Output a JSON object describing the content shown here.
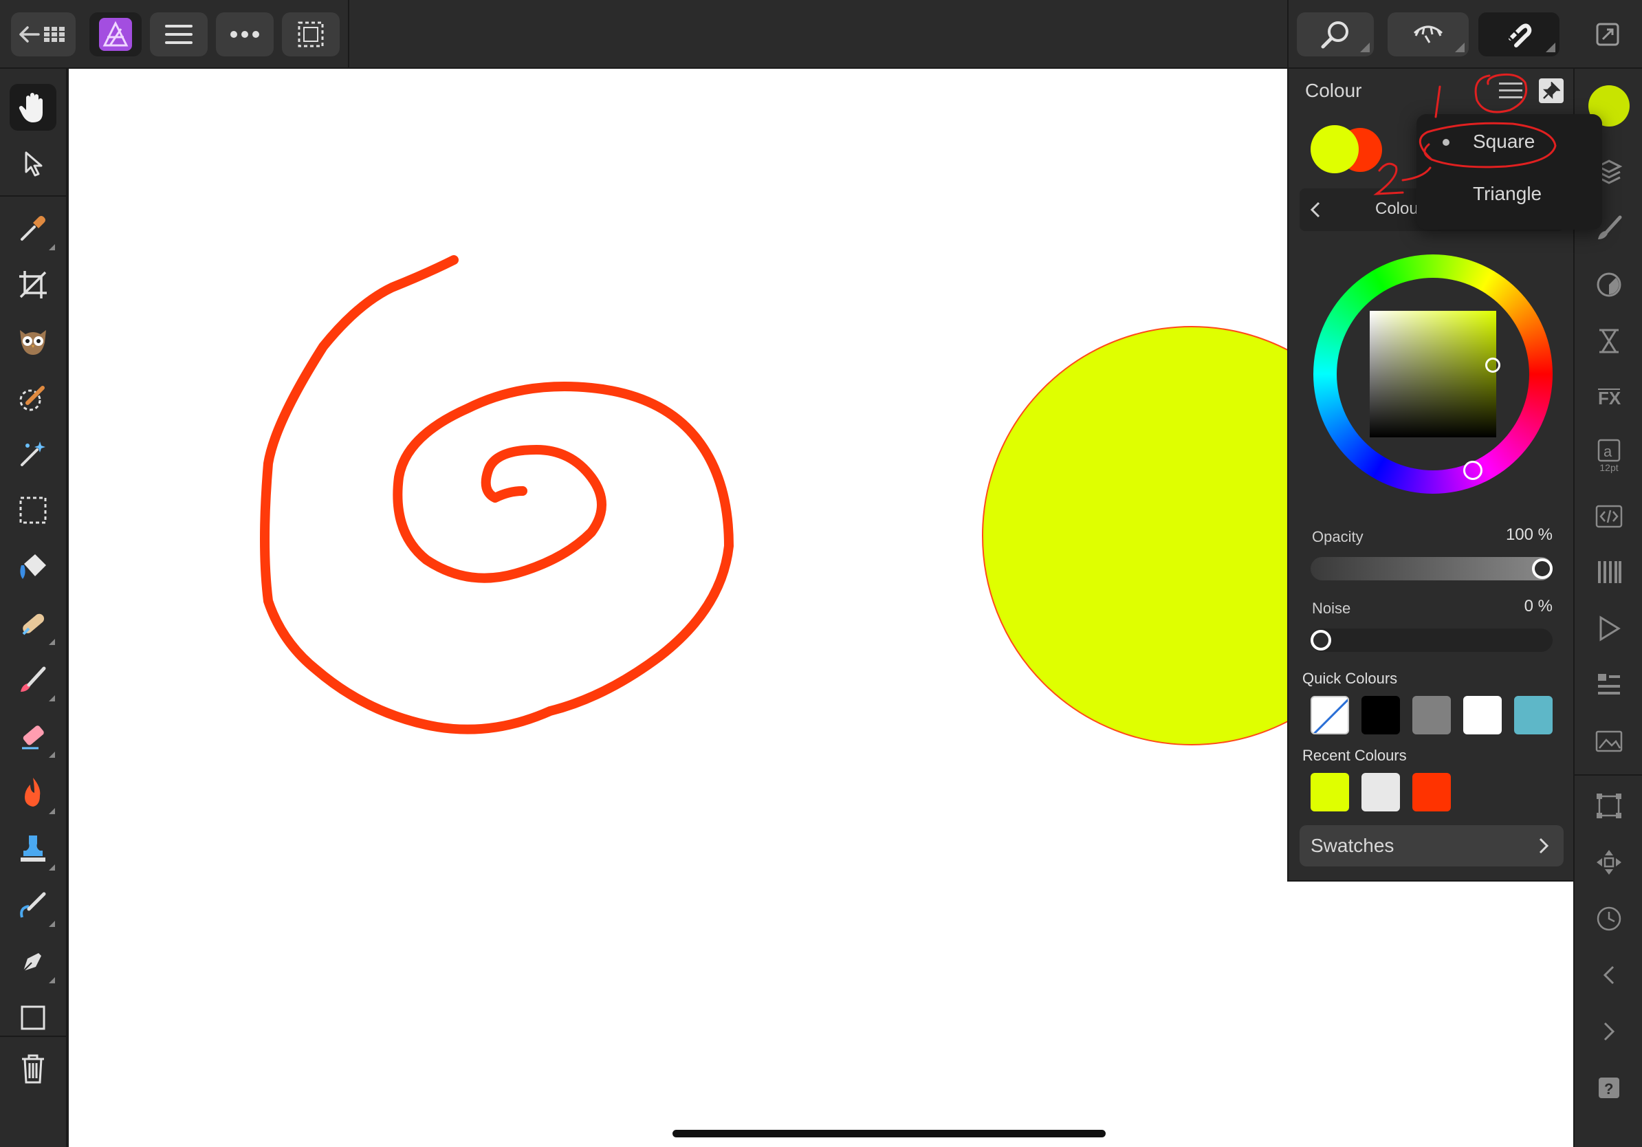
{
  "app": {
    "accent_color": "#a34ee0"
  },
  "top_toolbar": {
    "left_buttons": [
      {
        "id": "back-to-gallery",
        "icon": "back-grid-icon"
      },
      {
        "id": "persona",
        "icon": "affinity-photo-logo"
      },
      {
        "id": "document-menu",
        "icon": "hamburger-icon"
      },
      {
        "id": "more-menu",
        "icon": "ellipsis-icon"
      },
      {
        "id": "selection",
        "icon": "marquee-icon"
      }
    ],
    "right_buttons": [
      {
        "id": "zoom",
        "icon": "magnifier-icon"
      },
      {
        "id": "view-quality",
        "icon": "eye-icon"
      },
      {
        "id": "snapping",
        "icon": "magnet-icon"
      },
      {
        "id": "fullscreen",
        "icon": "expand-icon"
      }
    ]
  },
  "left_tools": [
    "hand-tool",
    "move-tool",
    "colour-picker-tool",
    "crop-tool",
    "owl-tool",
    "selection-brush-tool",
    "magic-wand-tool",
    "marquee-tool",
    "flood-fill-tool",
    "healing-brush-tool",
    "paint-brush-tool",
    "erase-brush-tool",
    "burn-tool",
    "clone-tool",
    "smudge-tool",
    "pen-tool",
    "rectangle-tool",
    "delete-tool"
  ],
  "colour_panel": {
    "title": "Colour",
    "primary_color": "#dfff00",
    "secondary_color": "#ff3300",
    "mode_label": "Colour",
    "menu": {
      "items": [
        {
          "label": "Square",
          "selected": true
        },
        {
          "label": "Triangle",
          "selected": false
        }
      ]
    },
    "opacity": {
      "label": "Opacity",
      "value_text": "100 %",
      "value": 1.0
    },
    "noise": {
      "label": "Noise",
      "value_text": "0 %",
      "value": 0.0
    },
    "quick_colours": {
      "label": "Quick Colours",
      "colors": [
        "none",
        "#000000",
        "#808080",
        "#ffffff",
        "#5eb7c8"
      ]
    },
    "recent_colours": {
      "label": "Recent Colours",
      "colors": [
        "#dfff00",
        "#e8e8e8",
        "#ff3300"
      ]
    },
    "swatches_label": "Swatches",
    "annotations": [
      "1",
      "2"
    ]
  },
  "right_studio": {
    "current_color": "#c8e400",
    "items": [
      "layers-icon",
      "brushes-icon",
      "adjustment-icon",
      "navigator-hourglass-icon",
      "fx-icon",
      "text-12pt-icon",
      "code-icon",
      "channels-icon",
      "play-macro-icon",
      "list-icon",
      "stock-icon",
      "transform-icon",
      "move-arrows-icon",
      "history-icon",
      "prev-icon",
      "next-icon",
      "help-icon"
    ],
    "text_item_size": "12pt"
  }
}
